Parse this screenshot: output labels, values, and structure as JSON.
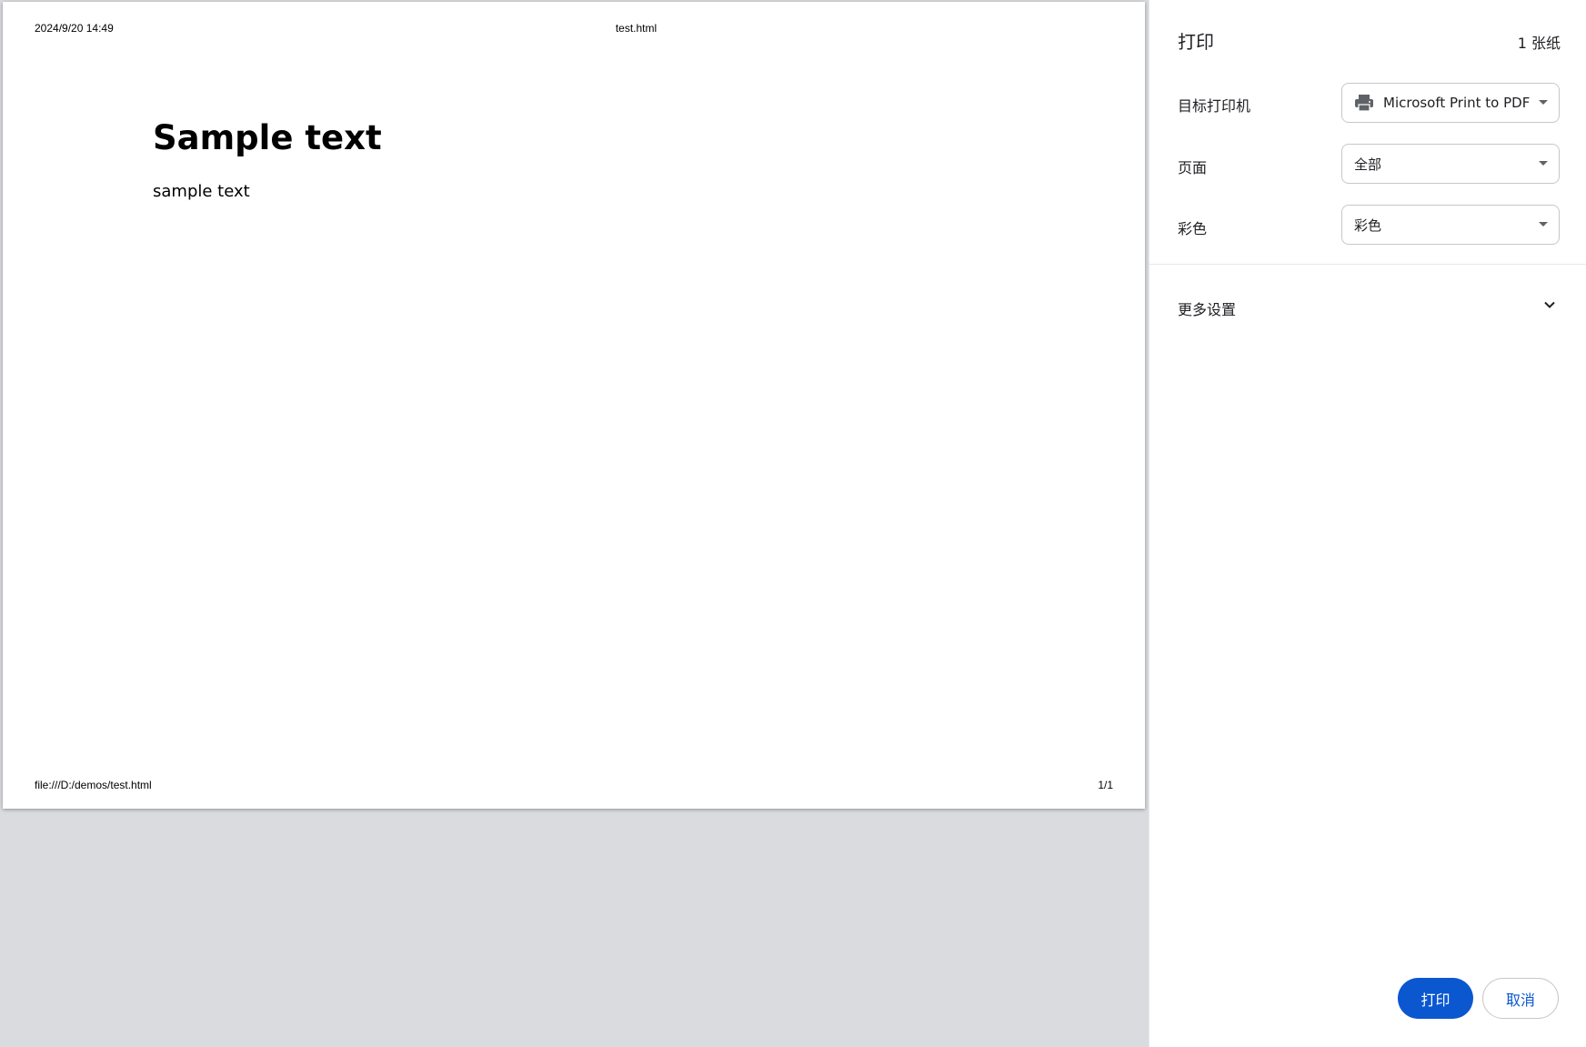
{
  "preview": {
    "header_left": "2024/9/20 14:49",
    "header_center": "test.html",
    "title": "Sample text",
    "body": "sample text",
    "footer_left": "file:///D:/demos/test.html",
    "footer_right": "1/1"
  },
  "sidebar": {
    "title": "打印",
    "sheet_count": "1 张纸",
    "destination": {
      "label": "目标打印机",
      "value": "Microsoft Print to PDF",
      "icon": "printer-icon"
    },
    "pages": {
      "label": "页面",
      "value": "全部"
    },
    "color": {
      "label": "彩色",
      "value": "彩色"
    },
    "more_settings": {
      "label": "更多设置",
      "icon": "chevron-down-icon"
    },
    "buttons": {
      "print": "打印",
      "cancel": "取消"
    }
  },
  "colors": {
    "accent": "#0b57d0",
    "preview_background": "#dadbdf"
  }
}
